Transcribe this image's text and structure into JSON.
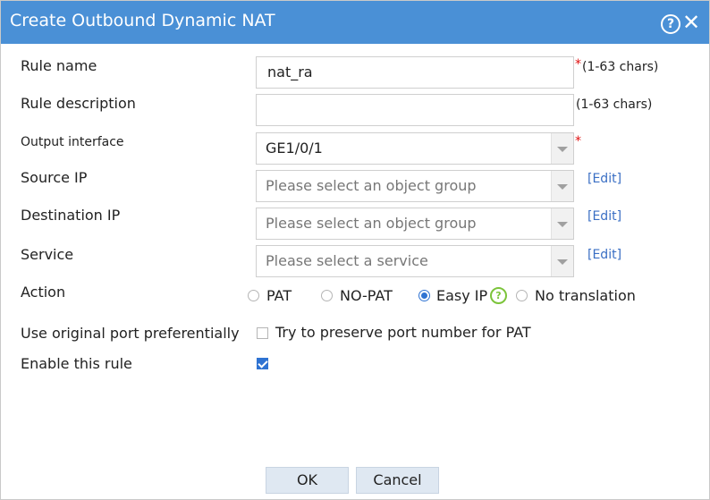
{
  "dialog": {
    "title": "Create Outbound Dynamic NAT",
    "help_glyph": "?",
    "close_glyph": "✕"
  },
  "form": {
    "rule_name": {
      "label": "Rule name",
      "value": "nat_ra",
      "required_mark": "*",
      "hint": "(1-63 chars)"
    },
    "rule_description": {
      "label": "Rule description",
      "value": "",
      "hint": "(1-63 chars)"
    },
    "output_interface": {
      "label": "Output interface",
      "value": "GE1/0/1",
      "required_mark": "*"
    },
    "source_ip": {
      "label": "Source IP",
      "placeholder": "Please select an object group",
      "edit_link": "[Edit]"
    },
    "destination_ip": {
      "label": "Destination IP",
      "placeholder": "Please select an object group",
      "edit_link": "[Edit]"
    },
    "service": {
      "label": "Service",
      "placeholder": "Please select a service",
      "edit_link": "[Edit]"
    },
    "action": {
      "label": "Action",
      "options": [
        "PAT",
        "NO-PAT",
        "Easy IP",
        "No translation"
      ],
      "selected": "Easy IP",
      "tip_glyph": "?"
    },
    "use_original_port": {
      "label": "Use original port preferentially",
      "checkbox_label": "Try to preserve port number for PAT",
      "checked": false
    },
    "enable_rule": {
      "label": "Enable this rule",
      "checked": true
    }
  },
  "buttons": {
    "ok": "OK",
    "cancel": "Cancel"
  },
  "colors": {
    "titlebar": "#4a90d6",
    "link": "#3a6fc4",
    "required": "#e01010",
    "accent": "#2f73d2",
    "tip": "#7cc43b",
    "button_bg": "#dfe8f2"
  }
}
